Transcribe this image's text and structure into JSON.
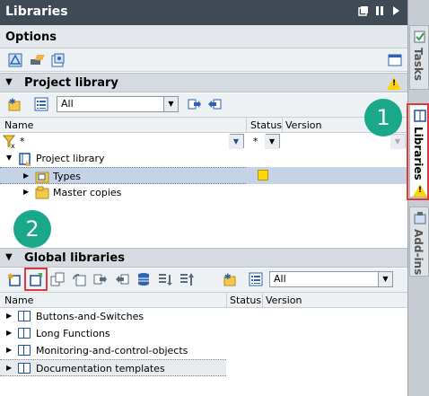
{
  "window": {
    "title": "Libraries"
  },
  "vertical_tabs": [
    {
      "label": "Tasks"
    },
    {
      "label": "Libraries"
    },
    {
      "label": "Add-ins"
    }
  ],
  "callouts": [
    "1",
    "2"
  ],
  "options": {
    "label": "Options"
  },
  "project_library": {
    "header": "Project library",
    "filter_value": "All",
    "columns": {
      "name": "Name",
      "status": "Status",
      "version": "Version"
    },
    "filter_row": {
      "name": "*",
      "status": "*"
    },
    "tree": [
      {
        "label": "Project library",
        "level": 0,
        "expanded": true
      },
      {
        "label": "Types",
        "level": 1,
        "expanded": false,
        "selected": true
      },
      {
        "label": "Master copies",
        "level": 1,
        "expanded": false
      }
    ]
  },
  "global_libraries": {
    "header": "Global libraries",
    "filter_value": "All",
    "columns": {
      "name": "Name",
      "status": "Status",
      "version": "Version"
    },
    "items": [
      {
        "label": "Buttons-and-Switches"
      },
      {
        "label": "Long Functions"
      },
      {
        "label": "Monitoring-and-control-objects"
      },
      {
        "label": "Documentation templates",
        "selected": true
      }
    ]
  },
  "colors": {
    "titlebar": "#3f4a55",
    "callout": "#1aa88a",
    "highlight_box": "#e0393b",
    "selection": "#c6d3e6",
    "status_yellow": "#ffd800"
  }
}
